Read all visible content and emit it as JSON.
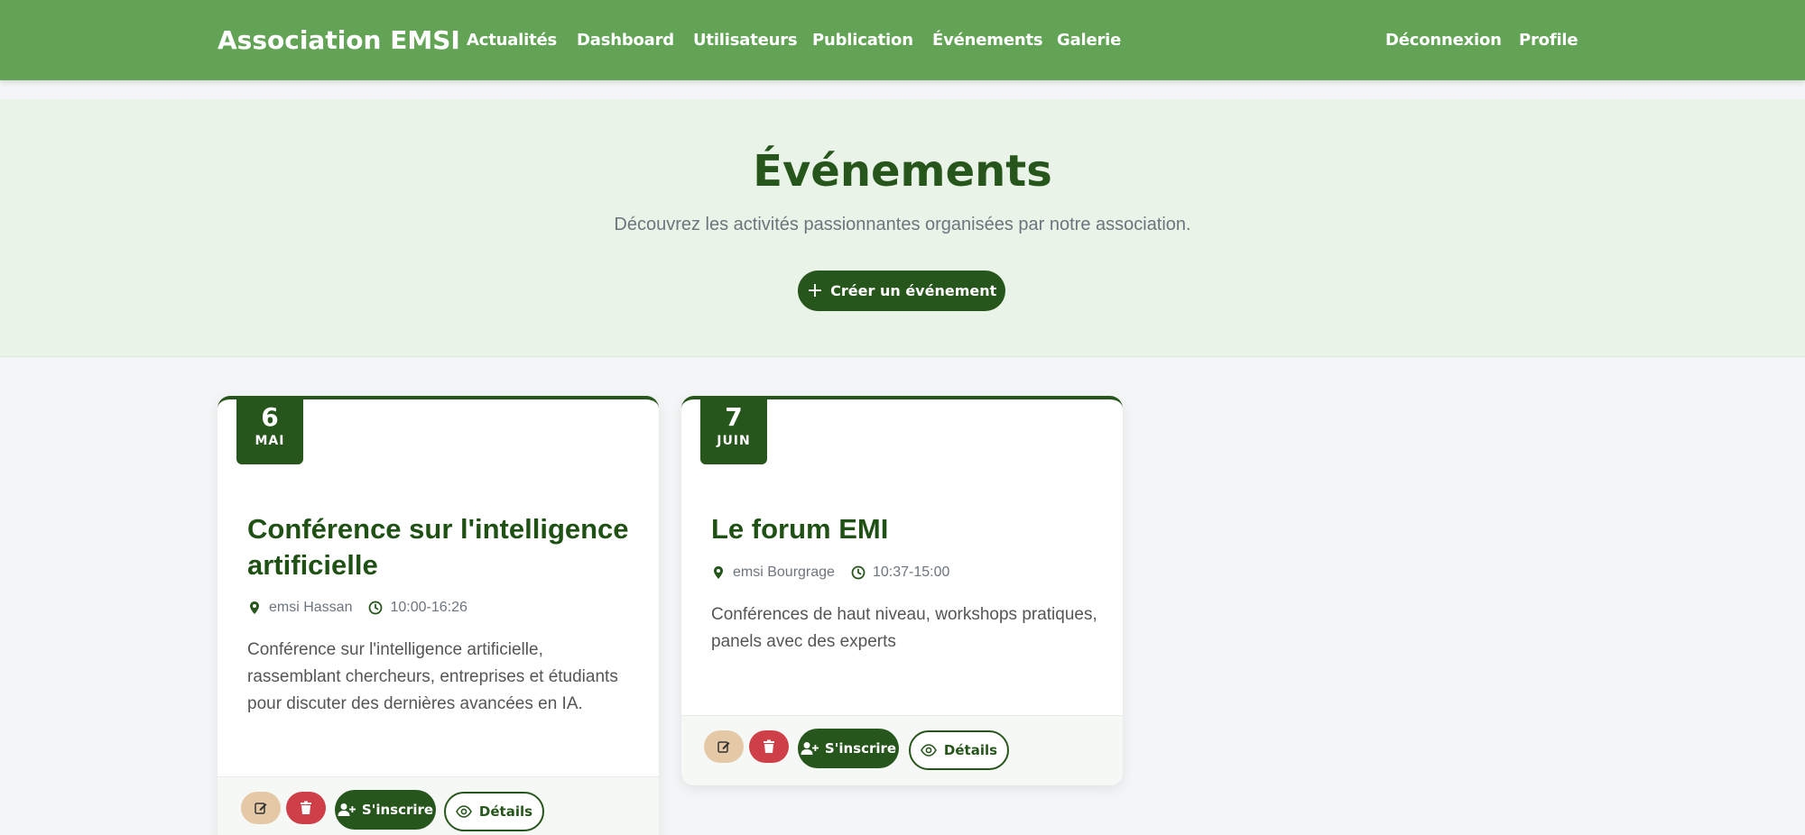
{
  "navbar": {
    "brand": "Association EMSI",
    "links": [
      "Actualités",
      "Dashboard",
      "Utilisateurs",
      "Publication",
      "Événements",
      "Galerie"
    ],
    "right_links": [
      "Déconnexion",
      "Profile"
    ],
    "background_color": "#63a356"
  },
  "hero": {
    "title": "Événements",
    "subtitle": "Découvrez les activités passionnantes organisées par notre association.",
    "create_button_label": "Créer un événement",
    "create_button_icon": "plus-icon"
  },
  "events": [
    {
      "day": "6",
      "month": "MAI",
      "title": "Conférence sur l'intelligence artificielle",
      "location": "emsi Hassan",
      "time": "10:00-16:26",
      "description": "Conférence sur l'intelligence artificielle, rassemblant chercheurs, entreprises et étudiants pour discuter des dernières avancées en IA.",
      "inscrire_label": "S'inscrire",
      "details_label": "Détails"
    },
    {
      "day": "7",
      "month": "JUIN",
      "title": "Le forum EMI",
      "location": "emsi Bourgrage",
      "time": "10:37-15:00",
      "description": "Conférences de haut niveau, workshops pratiques, panels avec des experts",
      "inscrire_label": "S'inscrire",
      "details_label": "Détails"
    }
  ],
  "colors": {
    "primary_dark_green": "#27561c",
    "hero_background": "#eaf3e7",
    "edit_button": "#e5c9a6",
    "delete_button": "#cf3f47"
  }
}
